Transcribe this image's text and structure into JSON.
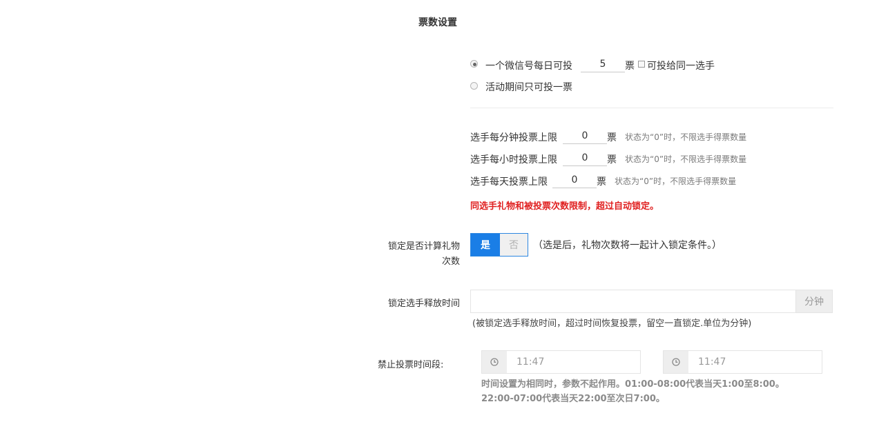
{
  "section_title": "票数设置",
  "vote_mode": {
    "option1_prefix": "一个微信号每日可投",
    "option1_value": "5",
    "option1_unit": "票",
    "same_player_label": "可投给同一选手",
    "option2_label": "活动期间只可投一票"
  },
  "limits": {
    "per_minute_label": "选手每分钟投票上限",
    "per_minute_value": "0",
    "per_hour_label": "选手每小时投票上限",
    "per_hour_value": "0",
    "per_day_label": "选手每天投票上限",
    "per_day_value": "0",
    "unit": "票",
    "hint": "状态为“0”时，不限选手得票数量",
    "warning": "同选手礼物和被投票次数限制，超过自动锁定。"
  },
  "lock_gift": {
    "label_line1": "锁定是否计算礼物",
    "label_line2": "次数",
    "yes": "是",
    "no": "否",
    "note": "（选是后，礼物次数将一起计入锁定条件。）"
  },
  "release_time": {
    "label": "锁定选手释放时间",
    "value": "",
    "addon": "分钟",
    "note": "(被锁定选手释放时间，超过时间恢复投票，留空一直锁定.单位为分钟)"
  },
  "forbid_time": {
    "label": "禁止投票时间段:",
    "start": "11:47",
    "end": "11:47",
    "note_line1": "时间设置为相同时，参数不起作用。01:00-08:00代表当天1:00至8:00。",
    "note_line2": "22:00-07:00代表当天22:00至次日7:00。"
  },
  "colors": {
    "primary": "#1a7ee6",
    "warning": "#e02020"
  }
}
